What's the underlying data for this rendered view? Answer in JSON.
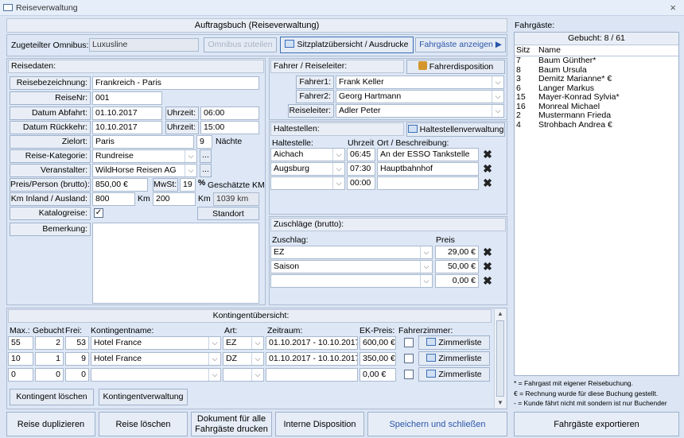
{
  "window": {
    "title": "Reiseverwaltung",
    "close": "×"
  },
  "header": {
    "title": "Auftragsbuch (Reiseverwaltung)"
  },
  "omnibus": {
    "label": "Zugeteilter Omnibus:",
    "value": "Luxusline",
    "assign_btn": "Omnibus zuteilen",
    "seat_btn": "Sitzplatzübersicht / Ausdrucke",
    "passengers_btn": "Fahrgäste anzeigen"
  },
  "reisedaten": {
    "title": "Reisedaten:",
    "bezeichnung_label": "Reisebezeichnung:",
    "bezeichnung": "Frankreich - Paris",
    "nr_label": "ReiseNr:",
    "nr": "001",
    "abfahrt_label": "Datum Abfahrt:",
    "abfahrt": "01.10.2017",
    "abfahrt_time_label": "Uhrzeit:",
    "abfahrt_time": "06:00",
    "rueckkehr_label": "Datum Rückkehr:",
    "rueckkehr": "10.10.2017",
    "rueckkehr_time_label": "Uhrzeit:",
    "rueckkehr_time": "15:00",
    "zielort_label": "Zielort:",
    "zielort": "Paris",
    "naechte": "9",
    "naechte_label": "Nächte",
    "kategorie_label": "Reise-Kategorie:",
    "kategorie": "Rundreise",
    "veranstalter_label": "Veranstalter:",
    "veranstalter": "WildHorse Reisen AG",
    "preis_label": "Preis/Person (brutto):",
    "preis": "850,00 €",
    "mwst_label": "MwSt:",
    "mwst": "19",
    "percent": "%",
    "geschaetzte": "Geschätzte KM",
    "km_label": "Km Inland / Ausland:",
    "km_inland": "800",
    "km_unit": "Km",
    "km_ausland": "200",
    "km_unit2": "Km",
    "km_total": "1039 km",
    "standort_btn": "Standort",
    "katalog_label": "Katalogreise:",
    "katalog_checked": "✓",
    "bemerkung_label": "Bemerkung:",
    "ellipsis": "..."
  },
  "fahrer": {
    "title": "Fahrer / Reiseleiter:",
    "dispo_btn": "Fahrerdisposition",
    "fahrer1_label": "Fahrer1:",
    "fahrer1": "Frank Keller",
    "fahrer2_label": "Fahrer2:",
    "fahrer2": "Georg Hartmann",
    "reiseleiter_label": "Reiseleiter:",
    "reiseleiter": "Adler Peter"
  },
  "haltestellen": {
    "title": "Haltestellen:",
    "btn": "Haltestellenverwaltung",
    "col_stop": "Haltestelle:",
    "col_time": "Uhrzeit",
    "col_desc": "Ort / Beschreibung:",
    "rows": [
      {
        "stop": "Aichach",
        "time": "06:45",
        "desc": "An der ESSO Tankstelle"
      },
      {
        "stop": "Augsburg",
        "time": "07:30",
        "desc": "Hauptbahnhof"
      },
      {
        "stop": "",
        "time": "00:00",
        "desc": ""
      }
    ]
  },
  "zuschlaege": {
    "title": "Zuschläge (brutto):",
    "col_name": "Zuschlag:",
    "col_price": "Preis",
    "rows": [
      {
        "name": "EZ",
        "price": "29,00 €"
      },
      {
        "name": "Saison",
        "price": "50,00 €"
      },
      {
        "name": "",
        "price": "0,00 €"
      }
    ]
  },
  "kontingent": {
    "title": "Kontingentübersicht:",
    "col_max": "Max.:",
    "col_gebucht": "Gebucht",
    "col_frei": "Frei:",
    "col_name": "Kontingentname:",
    "col_art": "Art:",
    "col_zeitraum": "Zeitraum:",
    "col_ek": "EK-Preis:",
    "col_fahrer": "Fahrerzimmer:",
    "zimmer_btn": "Zimmerliste",
    "rows": [
      {
        "max": "55",
        "gebucht": "2",
        "frei": "53",
        "name": "Hotel France",
        "art": "EZ",
        "zeitraum": "01.10.2017 - 10.10.2017",
        "ek": "600,00 €"
      },
      {
        "max": "10",
        "gebucht": "1",
        "frei": "9",
        "name": "Hotel France",
        "art": "DZ",
        "zeitraum": "01.10.2017 - 10.10.2017",
        "ek": "350,00 €"
      },
      {
        "max": "0",
        "gebucht": "0",
        "frei": "0",
        "name": "",
        "art": "",
        "zeitraum": "",
        "ek": "0,00 €"
      }
    ],
    "delete_btn": "Kontingent löschen",
    "manage_btn": "Kontingentverwaltung"
  },
  "fahrgaeste": {
    "title": "Fahrgäste:",
    "gebucht": "Gebucht: 8 / 61",
    "col_sitz": "Sitz",
    "col_name": "Name",
    "rows": [
      {
        "sitz": "7",
        "name": "Baum Günther*"
      },
      {
        "sitz": "8",
        "name": "Baum Ursula"
      },
      {
        "sitz": "3",
        "name": "Demitz Marianne* €"
      },
      {
        "sitz": "6",
        "name": "Langer Markus"
      },
      {
        "sitz": "15",
        "name": "Mayer-Konrad Sylvia*"
      },
      {
        "sitz": "16",
        "name": "Monreal Michael"
      },
      {
        "sitz": "2",
        "name": "Mustermann Frieda"
      },
      {
        "sitz": "4",
        "name": "Strohbach Andrea €"
      }
    ],
    "legend1": "* = Fahrgast mit eigener Reisebuchung.",
    "legend2": "€ = Rechnung wurde für diese Buchung gestellt.",
    "legend3": "- = Kunde fährt nicht mit sondern ist nur Buchender"
  },
  "footer": {
    "dup": "Reise duplizieren",
    "del": "Reise löschen",
    "doc_line1": "Dokument für alle",
    "doc_line2": "Fahrgäste drucken",
    "dispo": "Interne Disposition",
    "save": "Speichern und schließen",
    "export": "Fahrgäste exportieren"
  }
}
